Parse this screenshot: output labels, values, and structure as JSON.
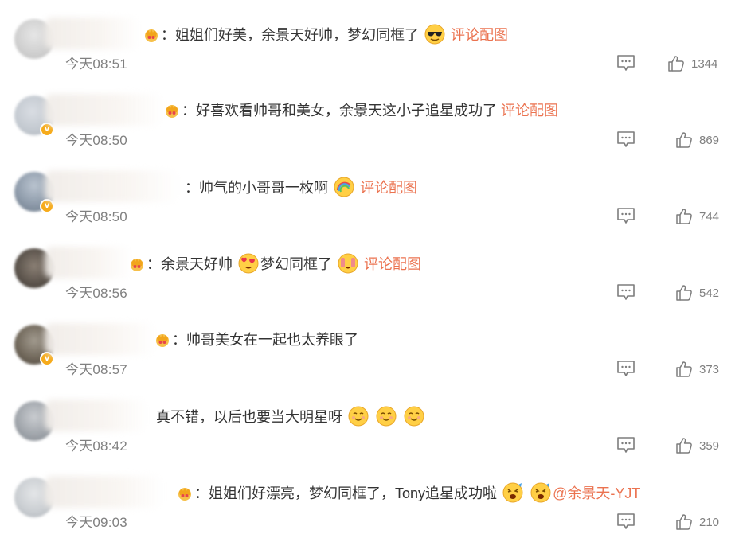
{
  "comments": [
    {
      "text": "：姐姐们好美，余景天好帅，梦幻同框了",
      "emojis": [
        "cool-sunglasses-emoji"
      ],
      "link": "评论配图",
      "time": "今天08:51",
      "likes": "1344",
      "verified": false
    },
    {
      "text": "：好喜欢看帅哥和美女，余景天这小子追星成功了",
      "emojis": [],
      "link": "评论配图",
      "time": "今天08:50",
      "likes": "869",
      "verified": true
    },
    {
      "text": "：帅气的小哥哥一枚啊",
      "emojis": [
        "rainbow-emoji"
      ],
      "link": "评论配图",
      "time": "今天08:50",
      "likes": "744",
      "verified": true
    },
    {
      "text_a": "：余景天好帅",
      "text_b": "梦幻同框了",
      "emojis": [
        "heart-eyes-emoji",
        "starstruck-emoji"
      ],
      "link": "评论配图",
      "time": "今天08:56",
      "likes": "542",
      "verified": false
    },
    {
      "text": "：帅哥美女在一起也太养眼了",
      "emojis": [],
      "link": "",
      "time": "今天08:57",
      "likes": "373",
      "verified": true
    },
    {
      "text": "真不错，以后也要当大明星呀",
      "emojis": [
        "smile-emoji",
        "smile-emoji",
        "smile-emoji"
      ],
      "link": "",
      "time": "今天08:42",
      "likes": "359",
      "verified": false
    },
    {
      "text": "：姐姐们好漂亮，梦幻同框了，Tony追星成功啦",
      "emojis": [
        "cheering-emoji",
        "cheering-emoji"
      ],
      "link": "@余景天-YJT",
      "time": "今天09:03",
      "likes": "210",
      "verified": false
    }
  ],
  "colors": {
    "link": "#eb7350",
    "text": "#333333",
    "meta": "#808080",
    "badge": "#f6ab1b"
  }
}
